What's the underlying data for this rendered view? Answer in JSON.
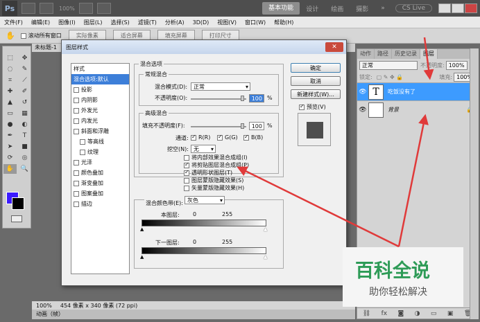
{
  "app": {
    "logo": "Ps",
    "zoom": "100%",
    "workspaces": [
      "基本功能",
      "设计",
      "绘画",
      "摄影",
      "»"
    ],
    "cslive": "CS Live"
  },
  "menubar": [
    "文件(F)",
    "编辑(E)",
    "图像(I)",
    "图层(L)",
    "选择(S)",
    "滤镜(T)",
    "分析(A)",
    "3D(D)",
    "视图(V)",
    "窗口(W)",
    "帮助(H)"
  ],
  "options": {
    "scroll_all": "滚动所有窗口",
    "buttons": [
      "实际像素",
      "适合屏幕",
      "填充屏幕",
      "打印尺寸"
    ]
  },
  "doc_tab": "未标题-1",
  "status": {
    "zoom": "100%",
    "size": "454 像素 x 340 像素 (72 ppi)"
  },
  "anim_label": "动画（帧）",
  "layers_panel": {
    "tabs": [
      "动作",
      "路径",
      "历史记录",
      "图层"
    ],
    "blend_mode": "正常",
    "opacity_label": "不透明度:",
    "opacity": "100%",
    "lock_label": "锁定:",
    "fill_label": "填充:",
    "fill": "100%",
    "layers": [
      {
        "name": "吃饭没有了",
        "thumb": "T",
        "active": true
      },
      {
        "name": "背景",
        "thumb": "",
        "active": false
      }
    ]
  },
  "dialog": {
    "title": "图层样式",
    "style_header": "样式",
    "styles": [
      {
        "label": "混合选项:默认",
        "hl": true,
        "check": false,
        "sub": false
      },
      {
        "label": "投影",
        "hl": false,
        "check": true,
        "sub": false
      },
      {
        "label": "内阴影",
        "hl": false,
        "check": true,
        "sub": false
      },
      {
        "label": "外发光",
        "hl": false,
        "check": true,
        "sub": false
      },
      {
        "label": "内发光",
        "hl": false,
        "check": true,
        "sub": false
      },
      {
        "label": "斜面和浮雕",
        "hl": false,
        "check": true,
        "sub": false
      },
      {
        "label": "等高线",
        "hl": false,
        "check": true,
        "sub": true
      },
      {
        "label": "纹理",
        "hl": false,
        "check": true,
        "sub": true
      },
      {
        "label": "光泽",
        "hl": false,
        "check": true,
        "sub": false
      },
      {
        "label": "颜色叠加",
        "hl": false,
        "check": true,
        "sub": false
      },
      {
        "label": "渐变叠加",
        "hl": false,
        "check": true,
        "sub": false
      },
      {
        "label": "图案叠加",
        "hl": false,
        "check": true,
        "sub": false
      },
      {
        "label": "描边",
        "hl": false,
        "check": true,
        "sub": false
      }
    ],
    "blend_options_title": "混合选项",
    "normal_blend": "常规混合",
    "blend_mode_label": "混合模式(D):",
    "blend_mode_value": "正常",
    "opacity_label": "不透明度(O):",
    "opacity_value": "100",
    "percent": "%",
    "advanced_blend": "高级混合",
    "fill_opacity_label": "填充不透明度(F):",
    "fill_opacity_value": "100",
    "channels_label": "通道:",
    "channels": [
      "R(R)",
      "G(G)",
      "B(B)"
    ],
    "knockout_label": "挖空(N):",
    "knockout_value": "无",
    "adv_checks": [
      {
        "label": "将内部效果混合成组(I)",
        "on": false
      },
      {
        "label": "将剪贴图层混合成组(P)",
        "on": true
      },
      {
        "label": "透明形状图层(T)",
        "on": true
      },
      {
        "label": "图层蒙版隐藏效果(S)",
        "on": false
      },
      {
        "label": "矢量蒙版隐藏效果(H)",
        "on": false
      }
    ],
    "blend_if_label": "混合颜色带(E):",
    "blend_if_value": "灰色",
    "this_layer_label": "本图层:",
    "underlying_label": "下一图层:",
    "range_min": "0",
    "range_max": "255",
    "buttons": {
      "ok": "确定",
      "cancel": "取消",
      "new_style": "新建样式(W)...",
      "preview": "预览(V)"
    }
  },
  "watermark": {
    "big": "百科全说",
    "small": "助你轻松解决"
  },
  "colors": {
    "foreground": "#3c1bff",
    "background": "#000000",
    "accent": "#3d9bff",
    "arrow": "#e03a3a"
  }
}
